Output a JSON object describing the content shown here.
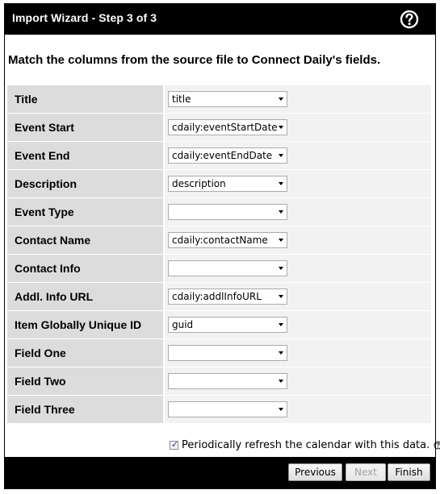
{
  "dialog": {
    "title": "Import Wizard - Step 3 of 3",
    "heading": "Match the columns from the source file to Connect Daily's fields.",
    "fields": [
      {
        "label": "Title",
        "value": "title"
      },
      {
        "label": "Event Start",
        "value": "cdaily:eventStartDate"
      },
      {
        "label": "Event End",
        "value": "cdaily:eventEndDate"
      },
      {
        "label": "Description",
        "value": "description"
      },
      {
        "label": "Event Type",
        "value": ""
      },
      {
        "label": "Contact Name",
        "value": "cdaily:contactName"
      },
      {
        "label": "Contact Info",
        "value": ""
      },
      {
        "label": "Addl. Info URL",
        "value": "cdaily:addlInfoURL"
      },
      {
        "label": "Item Globally Unique ID",
        "value": "guid"
      },
      {
        "label": "Field One",
        "value": ""
      },
      {
        "label": "Field Two",
        "value": ""
      },
      {
        "label": "Field Three",
        "value": ""
      }
    ],
    "refresh_label": "Periodically refresh the calendar with this data.",
    "refresh_checked": true,
    "buttons": {
      "previous": "Previous",
      "next": "Next",
      "finish": "Finish"
    }
  },
  "icons": {
    "help": "help-icon",
    "small_help": "small-help-icon"
  },
  "colors": {
    "titlebar": "#000000",
    "label_bg": "#dcdcdc",
    "cell_bg": "#f2f2f2"
  }
}
